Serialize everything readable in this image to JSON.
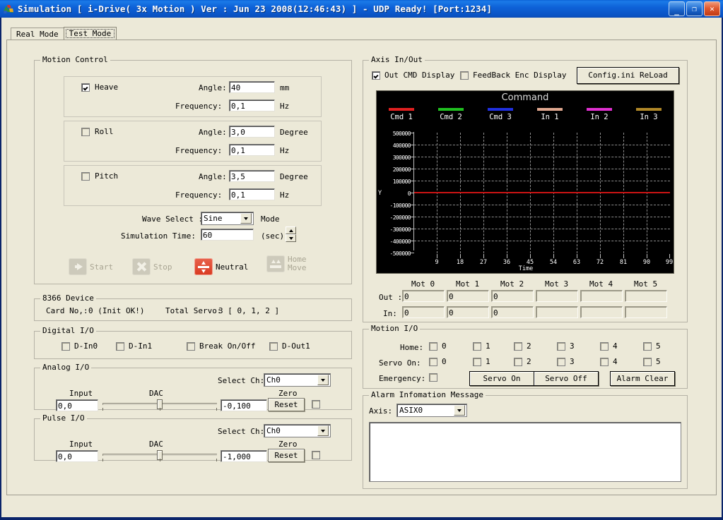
{
  "window": {
    "title": "Simulation [ i-Drive( 3x Motion )  Ver : Jun 23 2008(12:46:43) ] - UDP Ready! [Port:1234]",
    "minimize": "_",
    "maximize": "❐",
    "close": "✕"
  },
  "tabs": [
    {
      "label": "Real Mode",
      "active": false
    },
    {
      "label": "Test Mode",
      "active": true
    }
  ],
  "motion_control": {
    "legend": "Motion Control",
    "axes": [
      {
        "name": "Heave",
        "checked": true,
        "angle_label": "Angle:",
        "angle_value": "40",
        "angle_unit": "mm",
        "freq_label": "Frequency:",
        "freq_value": "0,1",
        "freq_unit": "Hz"
      },
      {
        "name": "Roll",
        "checked": false,
        "angle_label": "Angle:",
        "angle_value": "3,0",
        "angle_unit": "Degree",
        "freq_label": "Frequency:",
        "freq_value": "0,1",
        "freq_unit": "Hz"
      },
      {
        "name": "Pitch",
        "checked": false,
        "angle_label": "Angle:",
        "angle_value": "3,5",
        "angle_unit": "Degree",
        "freq_label": "Frequency:",
        "freq_value": "0,1",
        "freq_unit": "Hz"
      }
    ],
    "wave_select_label": "Wave Select :",
    "wave_select_value": "Sine",
    "wave_mode_suffix": "Mode",
    "sim_time_label": "Simulation Time:",
    "sim_time_value": "60",
    "sim_time_unit": "(sec)",
    "buttons": {
      "start": "Start",
      "stop": "Stop",
      "neutral": "Neutral",
      "home_move_line1": "Home",
      "home_move_line2": "Move"
    }
  },
  "device": {
    "legend": "8366 Device",
    "card_no_label": "Card No,:",
    "card_no_value": "0 (Init OK!)",
    "total_servo_label": "Total Servo:",
    "total_servo_value": "3 [ 0, 1, 2 ]"
  },
  "digital_io": {
    "legend": "Digital I/O",
    "items": [
      {
        "label": "D-In0",
        "checked": false
      },
      {
        "label": "D-In1",
        "checked": false
      },
      {
        "label": "Break On/Off",
        "checked": false
      },
      {
        "label": "D-Out1",
        "checked": false
      }
    ]
  },
  "analog_io": {
    "legend": "Analog I/O",
    "select_ch_label": "Select Ch:",
    "select_ch_value": "Ch0",
    "input_label": "Input",
    "input_value": "0,0",
    "dac_label": "DAC",
    "dac_value": "-0,100",
    "zero_label": "Zero",
    "reset_label": "Reset",
    "zero_checked": false
  },
  "pulse_io": {
    "legend": "Pulse I/O",
    "select_ch_label": "Select Ch:",
    "select_ch_value": "Ch0",
    "input_label": "Input",
    "input_value": "0,0",
    "dac_label": "DAC",
    "dac_value": "-1,000",
    "zero_label": "Zero",
    "reset_label": "Reset",
    "zero_checked": false
  },
  "axis_inout": {
    "legend": "Axis In/Out",
    "out_cmd_display_label": "Out CMD Display",
    "out_cmd_display_checked": true,
    "feedback_enc_label": "FeedBack Enc Display",
    "feedback_enc_checked": false,
    "reload_button": "Config.ini   ReLoad",
    "columns": [
      "Mot 0",
      "Mot 1",
      "Mot 2",
      "Mot 3",
      "Mot 4",
      "Mot 5"
    ],
    "out_label": "Out :",
    "out_values": [
      "0",
      "0",
      "0",
      "",
      "",
      ""
    ],
    "in_label": "In:",
    "in_values": [
      "0",
      "0",
      "0",
      "",
      "",
      ""
    ]
  },
  "chart_data": {
    "type": "line",
    "title": "Command",
    "xlabel": "Time",
    "ylabel": "Y",
    "xlim": [
      0,
      99
    ],
    "ylim": [
      -500000,
      500000
    ],
    "xticks": [
      9,
      18,
      27,
      36,
      45,
      54,
      63,
      72,
      81,
      90,
      99
    ],
    "yticks": [
      500000,
      400000,
      300000,
      200000,
      100000,
      0,
      -100000,
      -200000,
      -300000,
      -400000,
      -500000
    ],
    "ytick_labels": [
      "500000",
      "400000",
      "300000",
      "200000",
      "100000",
      "0",
      "-100000",
      "-200000",
      "-300000",
      "-400000",
      "-500000"
    ],
    "grid": true,
    "legend_position": "top",
    "background": "#000000",
    "series": [
      {
        "name": "Cmd 1",
        "color": "#e02020",
        "values": [
          0,
          0,
          0,
          0,
          0,
          0,
          0,
          0,
          0,
          0,
          0
        ],
        "visible": true
      },
      {
        "name": "Cmd 2",
        "color": "#20c020",
        "values": [],
        "visible": false
      },
      {
        "name": "Cmd 3",
        "color": "#2030e0",
        "values": [],
        "visible": false
      },
      {
        "name": "In 1",
        "color": "#e0a890",
        "values": [],
        "visible": false
      },
      {
        "name": "In 2",
        "color": "#e030d0",
        "values": [],
        "visible": false
      },
      {
        "name": "In 3",
        "color": "#b08828",
        "values": [],
        "visible": false
      }
    ]
  },
  "motion_io": {
    "legend": "Motion I/O",
    "home_label": "Home:",
    "home_items": [
      {
        "label": "0",
        "checked": false
      },
      {
        "label": "1",
        "checked": false
      },
      {
        "label": "2",
        "checked": false
      },
      {
        "label": "3",
        "checked": false
      },
      {
        "label": "4",
        "checked": false
      },
      {
        "label": "5",
        "checked": false
      }
    ],
    "servo_on_label": "Servo On:",
    "servo_items": [
      {
        "label": "0",
        "checked": false
      },
      {
        "label": "1",
        "checked": false
      },
      {
        "label": "2",
        "checked": false
      },
      {
        "label": "3",
        "checked": false
      },
      {
        "label": "4",
        "checked": false
      },
      {
        "label": "5",
        "checked": false
      }
    ],
    "emergency_label": "Emergency:",
    "emergency_checked": false,
    "servo_on_button": "Servo On",
    "servo_off_button": "Servo Off",
    "alarm_clear_button": "Alarm Clear"
  },
  "alarm": {
    "legend": "Alarm Infomation Message",
    "axis_label": "Axis:",
    "axis_value": "ASIX0",
    "message": ""
  }
}
